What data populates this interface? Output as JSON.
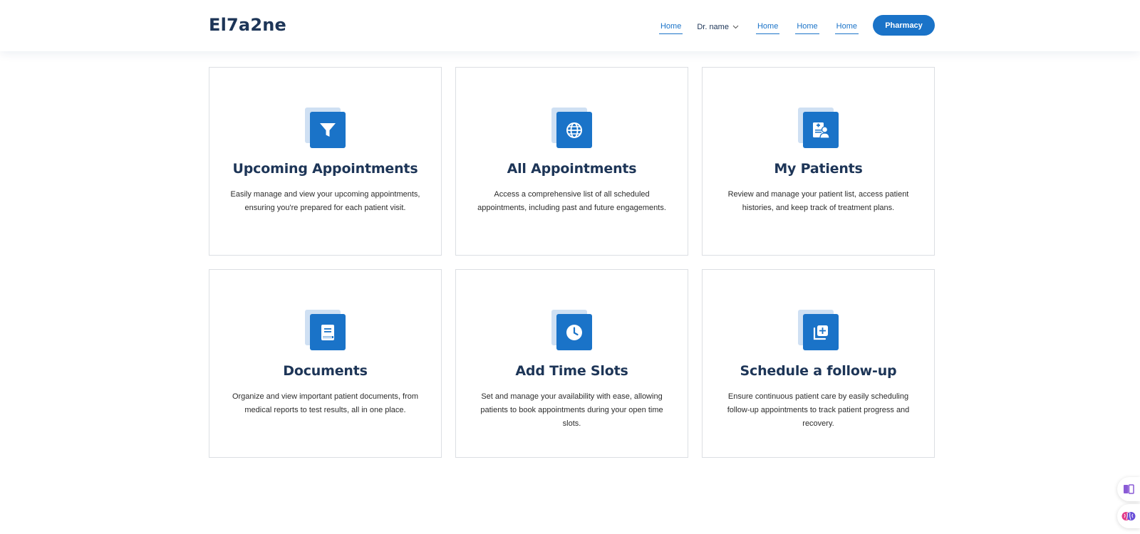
{
  "header": {
    "logo": "El7a2ne",
    "nav": {
      "link1": "Home",
      "dropdown": "Dr. name",
      "link2": "Home",
      "link3": "Home",
      "link4": "Home"
    },
    "pharmacy_button": "Pharmacy"
  },
  "colors": {
    "accent": "#1a73c8",
    "heading": "#1d3557",
    "icon_back": "#cfe0f3"
  },
  "cards": [
    {
      "title": "Upcoming Appointments",
      "description": "Easily manage and view your upcoming appointments, ensuring you're prepared for each patient visit.",
      "icon": "filter-icon"
    },
    {
      "title": "All Appointments",
      "description": "Access a comprehensive list of all scheduled appointments, including past and future engagements.",
      "icon": "globe-icon"
    },
    {
      "title": "My Patients",
      "description": "Review and manage your patient list, access patient histories, and keep track of treatment plans.",
      "icon": "patient-record-icon"
    },
    {
      "title": "Documents",
      "description": "Organize and view important patient documents, from medical reports to test results, all in one place.",
      "icon": "book-icon"
    },
    {
      "title": "Add Time Slots",
      "description": "Set and manage your availability with ease, allowing patients to book appointments during your open time slots.",
      "icon": "clock-icon"
    },
    {
      "title": "Schedule a follow-up",
      "description": "Ensure continuous patient care by easily scheduling follow-up appointments to track patient progress and recovery.",
      "icon": "add-copy-icon"
    }
  ],
  "side_widgets": [
    "reader-icon",
    "brain-icon"
  ]
}
